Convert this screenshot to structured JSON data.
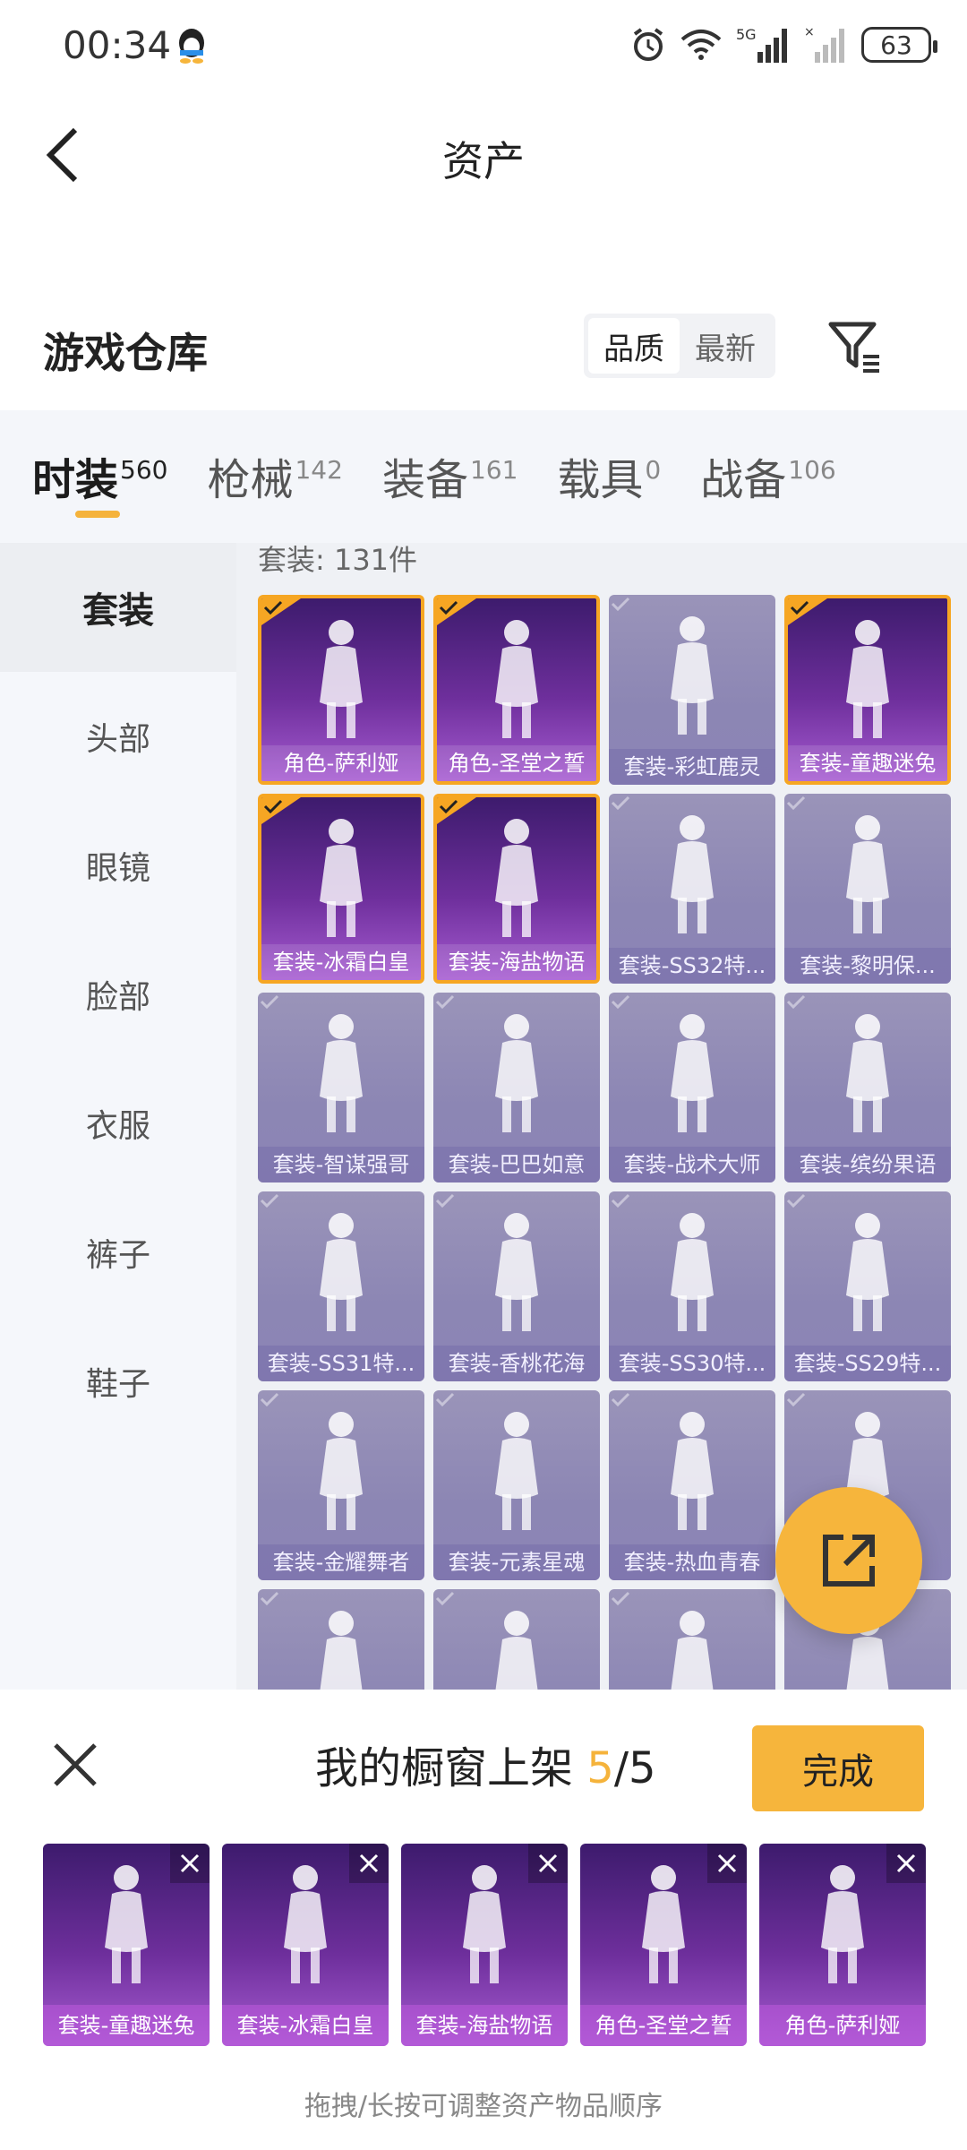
{
  "status": {
    "time": "00:34",
    "battery": "63",
    "network": "5G"
  },
  "header": {
    "title": "资产"
  },
  "warehouse": {
    "title": "游戏仓库",
    "sort_options": [
      "品质",
      "最新"
    ],
    "active_sort": "品质"
  },
  "tabs": [
    {
      "label": "时装",
      "count": "560",
      "active": true
    },
    {
      "label": "枪械",
      "count": "142"
    },
    {
      "label": "装备",
      "count": "161"
    },
    {
      "label": "载具",
      "count": "0"
    },
    {
      "label": "战备",
      "count": "106"
    }
  ],
  "sidebar": {
    "items": [
      "套装",
      "头部",
      "眼镜",
      "脸部",
      "衣服",
      "裤子",
      "鞋子"
    ],
    "active": "套装"
  },
  "content": {
    "count_label": "套装: 131件",
    "items": [
      {
        "name": "角色-萨利娅",
        "selected": true
      },
      {
        "name": "角色-圣堂之誓",
        "selected": true
      },
      {
        "name": "套装-彩虹鹿灵",
        "selected": false
      },
      {
        "name": "套装-童趣迷兔",
        "selected": true
      },
      {
        "name": "套装-冰霜白皇",
        "selected": true
      },
      {
        "name": "套装-海盐物语",
        "selected": true
      },
      {
        "name": "套装-SS32特...",
        "selected": false
      },
      {
        "name": "套装-黎明保...",
        "selected": false
      },
      {
        "name": "套装-智谋强哥",
        "selected": false
      },
      {
        "name": "套装-巴巴如意",
        "selected": false
      },
      {
        "name": "套装-战术大师",
        "selected": false
      },
      {
        "name": "套装-缤纷果语",
        "selected": false
      },
      {
        "name": "套装-SS31特...",
        "selected": false
      },
      {
        "name": "套装-香桃花海",
        "selected": false
      },
      {
        "name": "套装-SS30特...",
        "selected": false
      },
      {
        "name": "套装-SS29特...",
        "selected": false
      },
      {
        "name": "套装-金耀舞者",
        "selected": false
      },
      {
        "name": "套装-元素星魂",
        "selected": false
      },
      {
        "name": "套装-热血青春",
        "selected": false
      },
      {
        "name": "",
        "selected": false
      },
      {
        "name": "",
        "selected": false
      },
      {
        "name": "",
        "selected": false
      },
      {
        "name": "",
        "selected": false
      },
      {
        "name": "",
        "selected": false
      }
    ]
  },
  "showcase": {
    "title": "我的橱窗上架",
    "current": "5",
    "separator": "/",
    "total": "5",
    "done_label": "完成",
    "items": [
      "套装-童趣迷兔",
      "套装-冰霜白皇",
      "套装-海盐物语",
      "角色-圣堂之誓",
      "角色-萨利娅"
    ],
    "hint": "拖拽/长按可调整资产物品顺序"
  },
  "colors": {
    "accent": "#f6b53c",
    "rare_purple": "#6e2f9c",
    "muted_lavender": "#8c86b4"
  },
  "icons": [
    "back-arrow-icon",
    "filter-icon",
    "alarm-icon",
    "wifi-icon",
    "signal-icon",
    "share-icon",
    "close-icon",
    "check-icon"
  ]
}
